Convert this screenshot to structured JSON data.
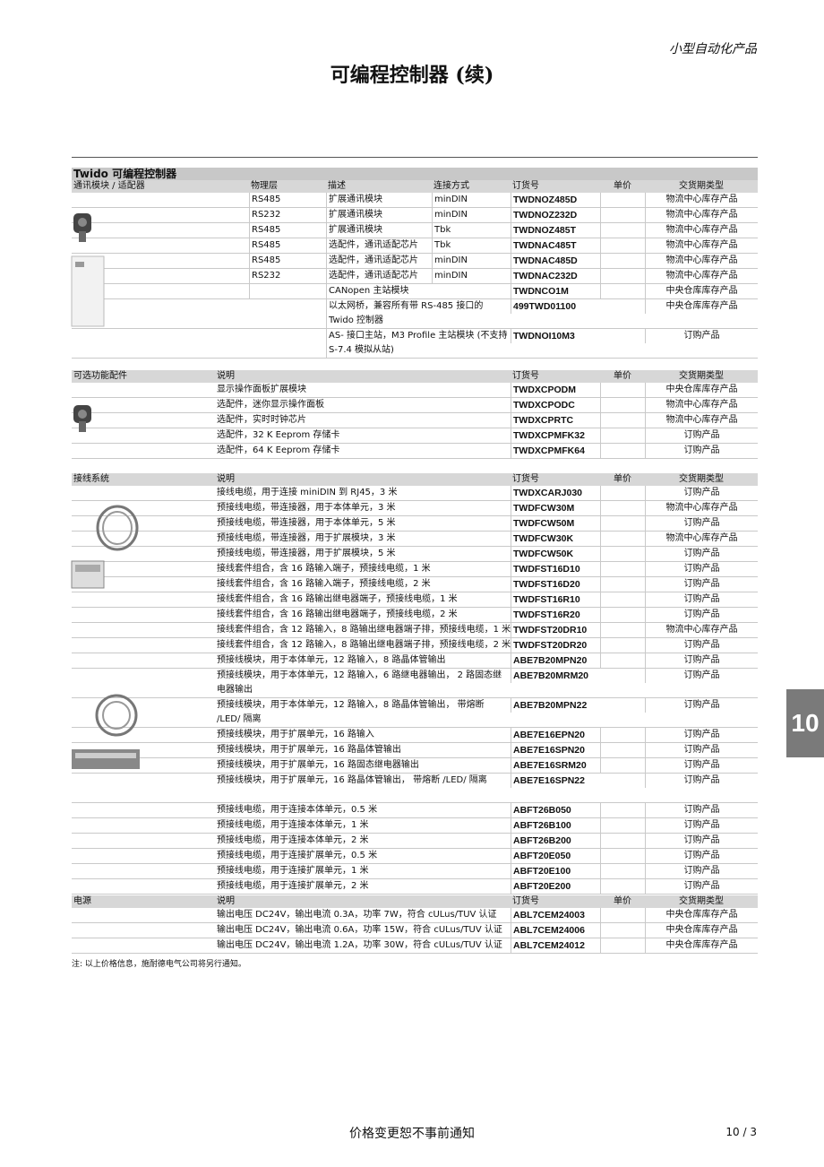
{
  "header_right": "小型自动化产品",
  "title": "可编程控制器 (续)",
  "section_title": "Twido 可编程控制器",
  "comm": {
    "headers": [
      "通讯模块 / 适配器",
      "物理层",
      "描述",
      "连接方式",
      "订货号",
      "单价",
      "交货期类型"
    ],
    "rows": [
      {
        "phys": "RS485",
        "desc": "扩展通讯模块",
        "conn": "minDIN",
        "ref": "TWDNOZ485D",
        "price": "",
        "lead": "物流中心库存产品"
      },
      {
        "phys": "RS232",
        "desc": "扩展通讯模块",
        "conn": "minDIN",
        "ref": "TWDNOZ232D",
        "price": "",
        "lead": "物流中心库存产品"
      },
      {
        "phys": "RS485",
        "desc": "扩展通讯模块",
        "conn": "Tbk",
        "ref": "TWDNOZ485T",
        "price": "",
        "lead": "物流中心库存产品"
      },
      {
        "phys": "RS485",
        "desc": "选配件，通讯适配芯片",
        "conn": "Tbk",
        "ref": "TWDNAC485T",
        "price": "",
        "lead": "物流中心库存产品"
      },
      {
        "phys": "RS485",
        "desc": "选配件，通讯适配芯片",
        "conn": "minDIN",
        "ref": "TWDNAC485D",
        "price": "",
        "lead": "物流中心库存产品"
      },
      {
        "phys": "RS232",
        "desc": "选配件，通讯适配芯片",
        "conn": "minDIN",
        "ref": "TWDNAC232D",
        "price": "",
        "lead": "物流中心库存产品"
      },
      {
        "phys": "",
        "desc": "CANopen 主站模块",
        "conn": "",
        "ref": "TWDNCO1M",
        "price": "",
        "lead": "中央仓库库存产品"
      },
      {
        "phys": "",
        "desc": "以太网桥，兼容所有带 RS-485 接口的 Twido 控制器",
        "conn": "",
        "ref": "499TWD01100",
        "price": "",
        "lead": "中央仓库库存产品",
        "tall": true
      },
      {
        "phys": "",
        "desc": "AS- 接口主站，M3 Profile 主站模块 (不支持 S-7.4 模拟从站)",
        "conn": "",
        "ref": "TWDNOI10M3",
        "price": "",
        "lead": "订购产品",
        "tall": true
      }
    ]
  },
  "options": {
    "headers": [
      "可选功能配件",
      "说明",
      "订货号",
      "单价",
      "交货期类型"
    ],
    "rows": [
      {
        "desc": "显示操作面板扩展模块",
        "ref": "TWDXCPODM",
        "price": "",
        "lead": "中央仓库库存产品"
      },
      {
        "desc": "选配件，迷你显示操作面板",
        "ref": "TWDXCPODC",
        "price": "",
        "lead": "物流中心库存产品"
      },
      {
        "desc": "选配件，实时时钟芯片",
        "ref": "TWDXCPRTC",
        "price": "",
        "lead": "物流中心库存产品"
      },
      {
        "desc": "选配件，32 K Eeprom 存储卡",
        "ref": "TWDXCPMFK32",
        "price": "",
        "lead": "订购产品"
      },
      {
        "desc": "选配件，64 K Eeprom 存储卡",
        "ref": "TWDXCPMFK64",
        "price": "",
        "lead": "订购产品"
      }
    ]
  },
  "wiring": {
    "headers": [
      "接线系统",
      "说明",
      "订货号",
      "单价",
      "交货期类型"
    ],
    "rows": [
      {
        "desc": "接线电缆，用于连接 miniDIN 到 RJ45，3 米",
        "ref": "TWDXCARJ030",
        "price": "",
        "lead": "订购产品"
      },
      {
        "desc": "预接线电缆，带连接器，用于本体单元，3 米",
        "ref": "TWDFCW30M",
        "price": "",
        "lead": "物流中心库存产品"
      },
      {
        "desc": "预接线电缆，带连接器，用于本体单元，5 米",
        "ref": "TWDFCW50M",
        "price": "",
        "lead": "订购产品"
      },
      {
        "desc": "预接线电缆，带连接器，用于扩展模块，3 米",
        "ref": "TWDFCW30K",
        "price": "",
        "lead": "物流中心库存产品"
      },
      {
        "desc": "预接线电缆，带连接器，用于扩展模块，5 米",
        "ref": "TWDFCW50K",
        "price": "",
        "lead": "订购产品"
      },
      {
        "desc": "接线套件组合，含 16 路输入端子，预接线电缆，1 米",
        "ref": "TWDFST16D10",
        "price": "",
        "lead": "订购产品"
      },
      {
        "desc": "接线套件组合，含 16 路输入端子，预接线电缆，2 米",
        "ref": "TWDFST16D20",
        "price": "",
        "lead": "订购产品"
      },
      {
        "desc": "接线套件组合，含 16 路输出继电器端子，预接线电缆，1 米",
        "ref": "TWDFST16R10",
        "price": "",
        "lead": "订购产品"
      },
      {
        "desc": "接线套件组合，含 16 路输出继电器端子，预接线电缆，2 米",
        "ref": "TWDFST16R20",
        "price": "",
        "lead": "订购产品"
      },
      {
        "desc": "接线套件组合，含 12 路输入，8 路输出继电器端子排，预接线电缆，1 米",
        "ref": "TWDFST20DR10",
        "price": "",
        "lead": "物流中心库存产品"
      },
      {
        "desc": "接线套件组合，含 12 路输入，8 路输出继电器端子排，预接线电缆，2 米",
        "ref": "TWDFST20DR20",
        "price": "",
        "lead": "订购产品"
      },
      {
        "desc": "预接线模块，用于本体单元，12 路输入，8 路晶体管输出",
        "ref": "ABE7B20MPN20",
        "price": "",
        "lead": "订购产品"
      },
      {
        "desc": "预接线模块，用于本体单元，12 路输入，6 路继电器输出， 2 路固态继电器输出",
        "ref": "ABE7B20MRM20",
        "price": "",
        "lead": "订购产品",
        "tall": true
      },
      {
        "desc": "预接线模块，用于本体单元，12 路输入，8 路晶体管输出， 带熔断 /LED/ 隔离",
        "ref": "ABE7B20MPN22",
        "price": "",
        "lead": "订购产品",
        "tall": true
      },
      {
        "desc": "预接线模块，用于扩展单元，16 路输入",
        "ref": "ABE7E16EPN20",
        "price": "",
        "lead": "订购产品"
      },
      {
        "desc": "预接线模块，用于扩展单元，16 路晶体管输出",
        "ref": "ABE7E16SPN20",
        "price": "",
        "lead": "订购产品"
      },
      {
        "desc": "预接线模块，用于扩展单元，16 路固态继电器输出",
        "ref": "ABE7E16SRM20",
        "price": "",
        "lead": "订购产品"
      },
      {
        "desc": "预接线模块，用于扩展单元，16 路晶体管输出， 带熔断 /LED/ 隔离",
        "ref": "ABE7E16SPN22",
        "price": "",
        "lead": "订购产品",
        "tall": true
      },
      {
        "desc": "预接线电缆，用于连接本体单元，0.5 米",
        "ref": "ABFT26B050",
        "price": "",
        "lead": "订购产品"
      },
      {
        "desc": "预接线电缆，用于连接本体单元，1 米",
        "ref": "ABFT26B100",
        "price": "",
        "lead": "订购产品"
      },
      {
        "desc": "预接线电缆，用于连接本体单元，2 米",
        "ref": "ABFT26B200",
        "price": "",
        "lead": "订购产品"
      },
      {
        "desc": "预接线电缆，用于连接扩展单元，0.5 米",
        "ref": "ABFT20E050",
        "price": "",
        "lead": "订购产品"
      },
      {
        "desc": "预接线电缆，用于连接扩展单元，1 米",
        "ref": "ABFT20E100",
        "price": "",
        "lead": "订购产品"
      },
      {
        "desc": "预接线电缆，用于连接扩展单元，2 米",
        "ref": "ABFT20E200",
        "price": "",
        "lead": "订购产品"
      }
    ]
  },
  "power": {
    "headers": [
      "电源",
      "说明",
      "订货号",
      "单价",
      "交货期类型"
    ],
    "rows": [
      {
        "desc": "输出电压 DC24V，输出电流 0.3A，功率 7W，符合 cULus/TUV 认证",
        "ref": "ABL7CEM24003",
        "price": "",
        "lead": "中央仓库库存产品"
      },
      {
        "desc": "输出电压 DC24V，输出电流 0.6A，功率 15W，符合 cULus/TUV 认证",
        "ref": "ABL7CEM24006",
        "price": "",
        "lead": "中央仓库库存产品"
      },
      {
        "desc": "输出电压 DC24V，输出电流 1.2A，功率 30W，符合 cULus/TUV 认证",
        "ref": "ABL7CEM24012",
        "price": "",
        "lead": "中央仓库库存产品"
      }
    ]
  },
  "note": "注: 以上价格信息，施耐德电气公司将另行通知。",
  "footer": "价格变更恕不事前通知",
  "page_number": "10 / 3",
  "chapter_tab": "10"
}
